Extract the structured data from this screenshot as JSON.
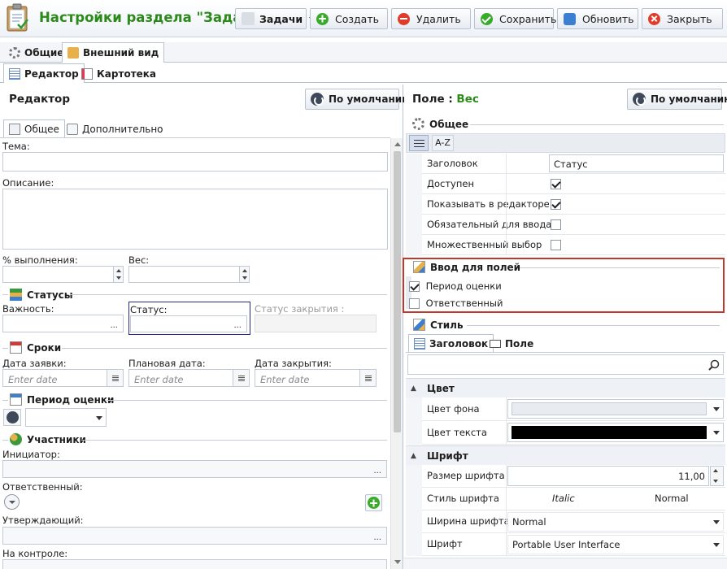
{
  "window": {
    "title": "Настройки раздела \"Задачи\""
  },
  "toolbar": {
    "section_label": "Задачи",
    "create_label": "Создать",
    "delete_label": "Удалить",
    "save_label": "Сохранить",
    "refresh_label": "Обновить",
    "close_label": "Закрыть"
  },
  "top_tabs": {
    "general": "Общие",
    "appearance": "Внешний вид"
  },
  "sub_tabs": {
    "editor": "Редактор",
    "card": "Картотека"
  },
  "editor": {
    "header": "Редактор",
    "default_button": "По умолчанию",
    "tabs": {
      "general": "Общее",
      "additional": "Дополнительно"
    },
    "fields": {
      "subject": "Тема:",
      "description": "Описание:",
      "percent_done": "% выполнения:",
      "weight": "Вес:",
      "importance": "Важность:",
      "status": "Статус:",
      "close_status": "Статус закрытия :",
      "request_date": "Дата заявки:",
      "planned_date": "Плановая дата:",
      "close_date": "Дата закрытия:",
      "initiator": "Инициатор:",
      "responsible": "Ответственный:",
      "approver": "Утверждающий:",
      "on_control": "На контроле:"
    },
    "sections": {
      "statuses": "Статусы",
      "deadlines": "Сроки",
      "evaluation_period": "Период оценки",
      "participants": "Участники"
    },
    "date_placeholder": "Enter date",
    "ellipsis": "..."
  },
  "field_panel": {
    "header_label": "Поле :",
    "field_name": "Вес",
    "default_button": "По умолчанию",
    "general_section": "Общее",
    "sort_az": "A-Z",
    "properties": [
      {
        "name": "Заголовок",
        "value": "Статус",
        "type": "text"
      },
      {
        "name": "Доступен",
        "checked": true,
        "type": "check"
      },
      {
        "name": "Показывать в редакторе",
        "checked": true,
        "type": "check"
      },
      {
        "name": "Обязательный для ввода",
        "checked": false,
        "type": "check"
      },
      {
        "name": "Множественный выбор",
        "checked": false,
        "type": "check"
      }
    ],
    "input_section": "Ввод для полей",
    "input_fields": [
      {
        "label": "Период оценки",
        "checked": true
      },
      {
        "label": "Ответственный",
        "checked": false
      }
    ],
    "style_section": "Стиль",
    "style_tabs": {
      "header": "Заголовок",
      "field": "Поле"
    },
    "color_category": "Цвет",
    "color_props": {
      "bg": "Цвет фона",
      "text": "Цвет текста"
    },
    "font_category": "Шрифт",
    "font_props": {
      "size_label": "Размер шрифта",
      "size_value": "11,00",
      "style_label": "Стиль шрифта",
      "style_italic": "Italic",
      "style_normal": "Normal",
      "weight_label": "Ширина шрифта",
      "weight_value": "Normal",
      "font_label": "Шрифт",
      "font_value": "Portable User Interface"
    }
  },
  "colors": {
    "title_green": "#2b8a1a",
    "highlight_border": "#c0392b",
    "active_field_border": "#27288c"
  }
}
